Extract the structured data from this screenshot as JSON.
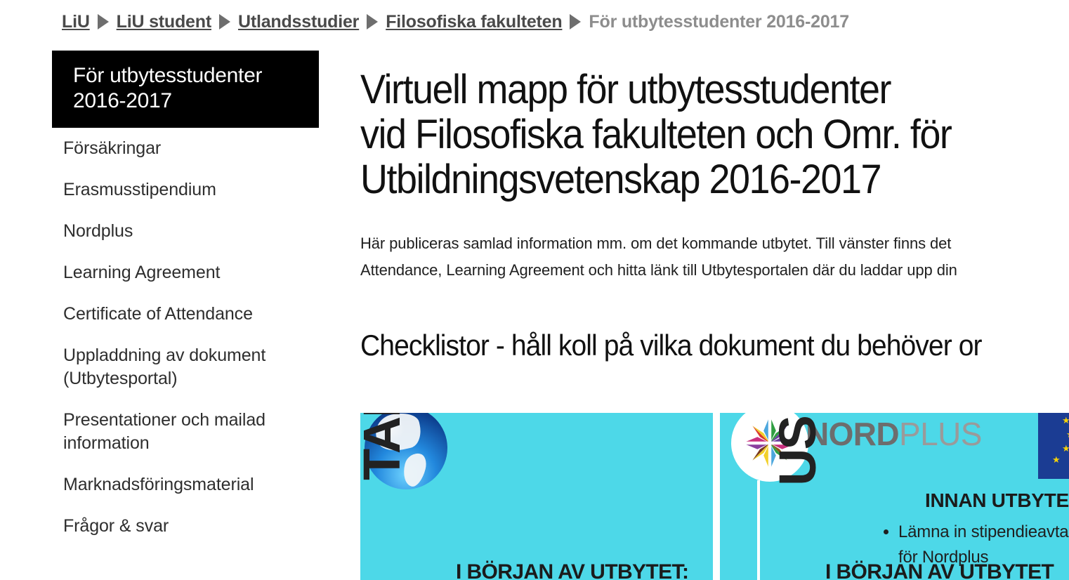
{
  "breadcrumb": {
    "items": [
      {
        "label": "LiU",
        "current": false
      },
      {
        "label": "LiU student",
        "current": false
      },
      {
        "label": "Utlandsstudier",
        "current": false
      },
      {
        "label": "Filosofiska fakulteten",
        "current": false
      },
      {
        "label": "För utbytesstudenter 2016-2017",
        "current": true
      }
    ],
    "separator_icon": "triangle-right-icon"
  },
  "sidebar": {
    "header": "För utbytesstudenter 2016-2017",
    "items": [
      {
        "label": "Försäkringar"
      },
      {
        "label": "Erasmusstipendium"
      },
      {
        "label": "Nordplus"
      },
      {
        "label": "Learning Agreement"
      },
      {
        "label": "Certificate of Attendance"
      },
      {
        "label": "Uppladdning av dokument (Utbytesportal)"
      },
      {
        "label": "Presentationer och mailad information"
      },
      {
        "label": "Marknadsföringsmaterial"
      },
      {
        "label": "Frågor & svar"
      }
    ]
  },
  "main": {
    "title": "Virtuell mapp för utbytesstudenter vid Filosofiska fakulteten och Omr. för Utbildningsvetenskap 2016-2017",
    "title_lines": [
      "Virtuell mapp för utbytesstudenter",
      "vid Filosofiska fakulteten och Omr. för",
      "Utbildningsvetenskap 2016-2017"
    ],
    "intro_lines": [
      "Här publiceras samlad information mm. om det kommande utbytet. Till vänster finns det",
      "Attendance, Learning Agreement och hitta länk till Utbytesportalen där du laddar upp din"
    ],
    "section_title": "Checklistor - håll koll på vilka dokument du behöver or"
  },
  "checklist_graphic": {
    "background_color": "#4dd8e8",
    "panels": [
      {
        "name": "erasmus",
        "vertical_word": "TAL",
        "bottom_heading": "I BÖRJAN AV UTBYTET:",
        "icon": "globe-icon"
      },
      {
        "name": "nordplus",
        "vertical_word": "US",
        "logo_bold": "NORD",
        "logo_light": "PLUS",
        "logo_icon": "nordplus-compass-star-icon",
        "section_title": "INNAN UTBYTET",
        "bullets": [
          "Lämna in stipendieavtal för Nordplus"
        ],
        "bottom_heading": "I BÖRJAN AV UTBYTET",
        "flag_icon": "eu-flag-icon"
      }
    ]
  },
  "colors": {
    "cyan": "#4dd8e8",
    "sidebar_header_bg": "#000000",
    "breadcrumb_text": "#4a4a4a",
    "breadcrumb_current": "#8d8d8d",
    "eu_blue": "#1b3c93",
    "eu_star_yellow": "#f5d108"
  }
}
